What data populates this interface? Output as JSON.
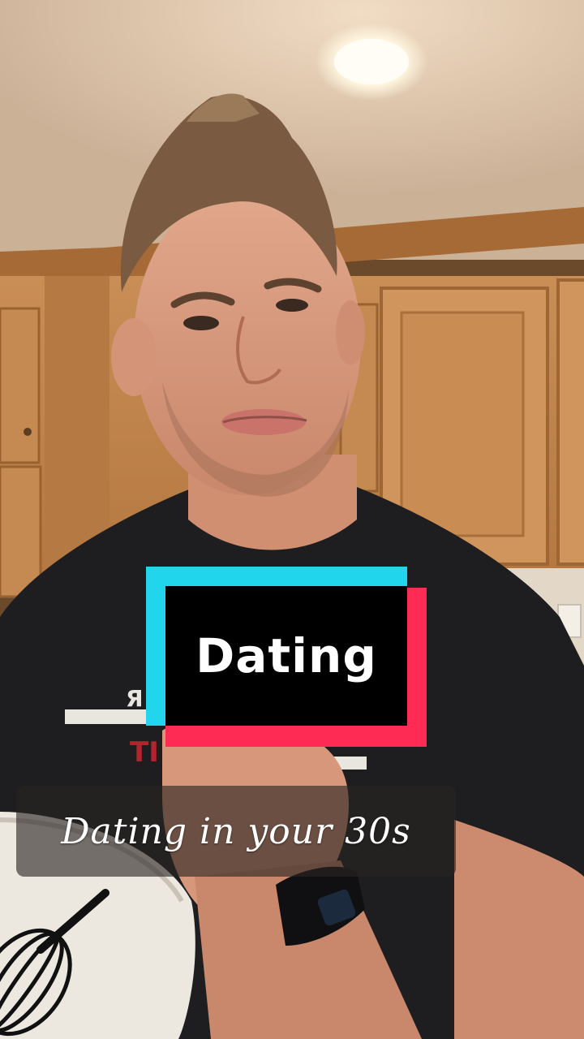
{
  "sticker": {
    "text": "Dating"
  },
  "caption": {
    "text": "Dating in your 30s"
  },
  "colors": {
    "sticker_cyan": "#20d5ec",
    "sticker_pink": "#fe2c55",
    "sticker_black": "#000000"
  },
  "scene": {
    "description_icons": [
      "ceiling-light-icon",
      "whisk-icon"
    ]
  }
}
